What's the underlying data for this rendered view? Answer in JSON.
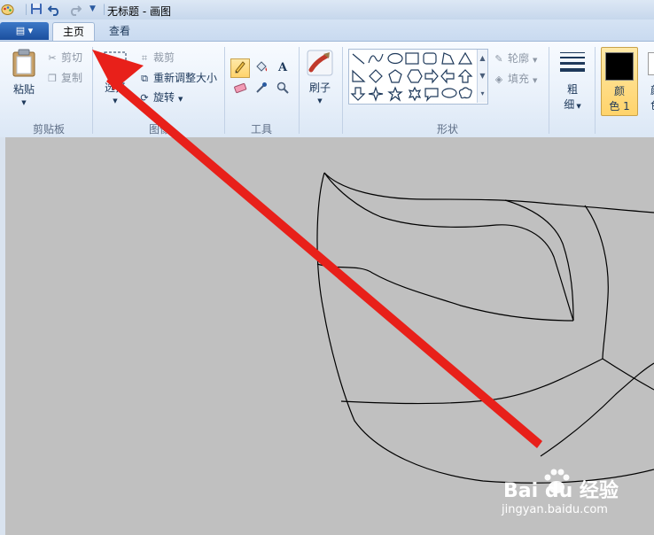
{
  "window": {
    "title": "无标题 - 画图"
  },
  "tabs": [
    {
      "label": "主页",
      "active": true
    },
    {
      "label": "查看",
      "active": false
    }
  ],
  "ribbon": {
    "clipboard": {
      "group_label": "剪贴板",
      "paste": "粘贴",
      "cut": "剪切",
      "copy": "复制"
    },
    "image": {
      "group_label": "图像",
      "select": "选择",
      "crop": "裁剪",
      "resize": "重新调整大小",
      "rotate": "旋转"
    },
    "tools": {
      "group_label": "工具",
      "items": [
        "pencil-icon",
        "fill-bucket-icon",
        "text-icon",
        "eraser-icon",
        "color-picker-icon",
        "magnifier-icon"
      ],
      "selected": "pencil-icon"
    },
    "brushes": {
      "label": "刷子"
    },
    "shapes": {
      "group_label": "形状",
      "outline": "轮廓",
      "fill": "填充"
    },
    "size": {
      "label_line1": "粗",
      "label_line2": "细"
    },
    "color1": {
      "label_line1": "颜",
      "label_line2": "色 1",
      "value": "#000000"
    },
    "color2_partial": {
      "label_line1": "颜",
      "label_line2": "色"
    }
  },
  "annotation": {
    "arrow_color": "#e8201a"
  },
  "watermark": {
    "brand": "Bai du 经验",
    "url": "jingyan.baidu.com"
  }
}
